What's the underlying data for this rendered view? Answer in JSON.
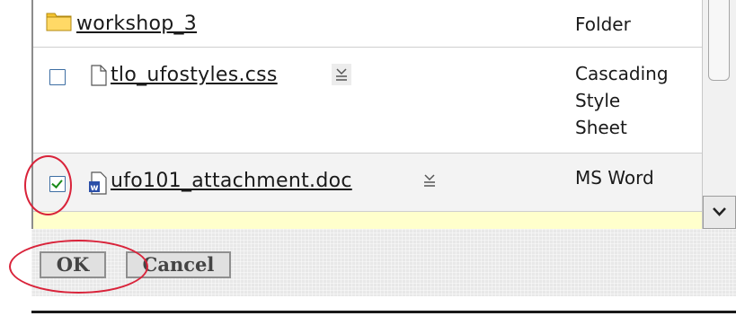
{
  "files": [
    {
      "name": "workshop_3",
      "type": "Folder",
      "icon": "folder-icon",
      "checkbox": false
    },
    {
      "name": "tlo_ufostyles.css",
      "type": "Cascading\nStyle\nSheet",
      "icon": "document-icon",
      "checkbox": true,
      "checked": false
    },
    {
      "name": "ufo101_attachment.doc",
      "type": "MS Word",
      "icon": "word-document-icon",
      "checkbox": true,
      "checked": true
    }
  ],
  "buttons": {
    "ok": "OK",
    "cancel": "Cancel"
  },
  "colors": {
    "annotation": "#d9233a",
    "highlight_row": "#ffffcc",
    "folder": "#f4c430",
    "checkbox_border": "#3d6ea3",
    "checkmark": "#1a8a1a"
  }
}
